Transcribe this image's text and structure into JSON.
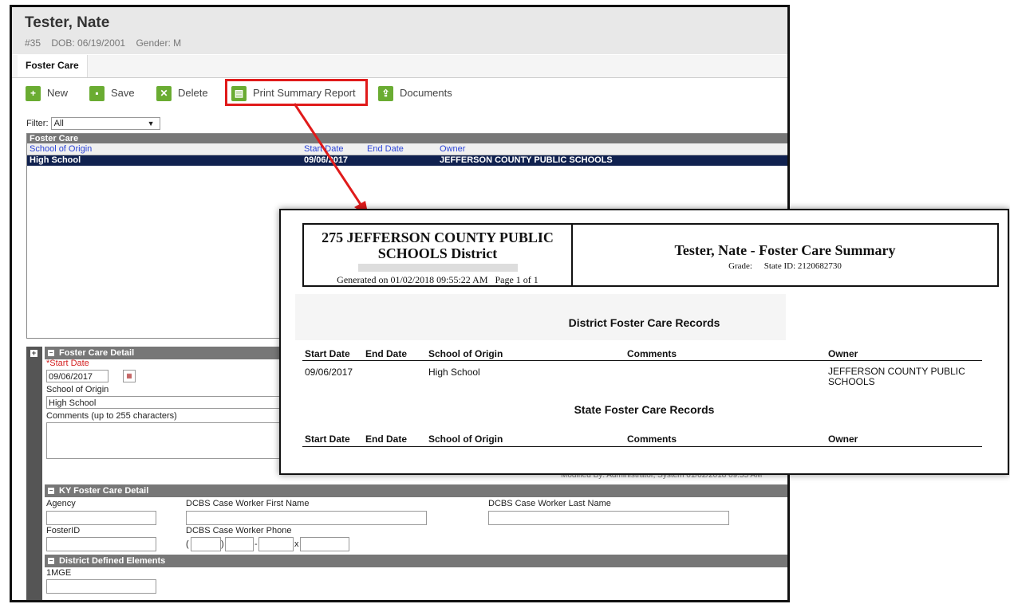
{
  "student": {
    "name": "Tester, Nate",
    "number": "#35",
    "dob": "DOB: 06/19/2001",
    "gender": "Gender: M"
  },
  "tab": "Foster Care",
  "toolbar": {
    "new": "New",
    "save": "Save",
    "delete": "Delete",
    "print": "Print Summary Report",
    "documents": "Documents"
  },
  "filter": {
    "label": "Filter:",
    "value": "All"
  },
  "grid": {
    "title": "Foster Care",
    "columns": [
      "School of Origin",
      "Start Date",
      "End Date",
      "Owner"
    ],
    "row": {
      "school": "High School",
      "start": "09/06/2017",
      "end": "",
      "owner": "JEFFERSON COUNTY PUBLIC SCHOOLS"
    }
  },
  "detail": {
    "title": "Foster Care Detail",
    "start_label": "*Start Date",
    "start_value": "09/06/2017",
    "school_label": "School of Origin",
    "school_value": "High School",
    "comments_label": "Comments (up to 255 characters)",
    "modified": "Modified By: Administrator, System 01/02/2018 09:55 AM"
  },
  "ky": {
    "title": "KY Foster Care Detail",
    "agency": "Agency",
    "first": "DCBS Case Worker First Name",
    "last": "DCBS Case Worker Last Name",
    "foster_id": "FosterID",
    "phone": "DCBS Case Worker Phone",
    "paren_open": "(",
    "paren_close": ")",
    "dash": "-",
    "x": "x"
  },
  "district_elements": {
    "title": "District Defined Elements",
    "field": "1MGE"
  },
  "report": {
    "district_line1": "275 JEFFERSON COUNTY PUBLIC",
    "district_line2": "SCHOOLS District",
    "generated": "Generated on 01/02/2018 09:55:22 AM",
    "page": "Page 1 of 1",
    "title": "Tester, Nate - Foster Care Summary",
    "grade": "Grade:",
    "state_id": "State ID: 2120682730",
    "district_section": "District Foster Care Records",
    "state_section": "State Foster Care Records",
    "headers": [
      "Start Date",
      "End Date",
      "School of Origin",
      "Comments",
      "Owner"
    ],
    "record": {
      "start": "09/06/2017",
      "school": "High School",
      "owner_line1": "JEFFERSON COUNTY PUBLIC",
      "owner_line2": "SCHOOLS"
    }
  },
  "colors": {
    "accent_green": "#6aac32",
    "highlight_red": "#e01a1a",
    "selected_row": "#10214f",
    "section_gray": "#777777"
  },
  "icons": {
    "new": "plus-circle-icon",
    "save": "save-icon",
    "delete": "x-circle-icon",
    "print": "printer-icon",
    "documents": "upload-icon"
  }
}
